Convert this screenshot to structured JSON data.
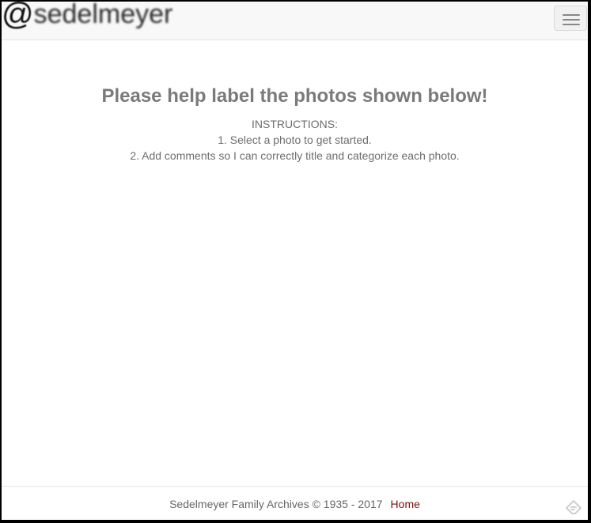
{
  "header": {
    "brand_symbol": "@",
    "brand_name": "sedelmeyer",
    "menu_icon": "hamburger-menu-icon"
  },
  "main": {
    "title": "Please help label the photos shown below!",
    "instructions_heading": "INSTRUCTIONS:",
    "instructions": [
      "1. Select a photo to get started.",
      "2. Add comments so I can correctly title and categorize each photo."
    ]
  },
  "footer": {
    "copyright": "Sedelmeyer Family Archives © 1935 - 2017",
    "home_link": "Home",
    "corner_icon": "feedly-icon"
  },
  "colors": {
    "navbar_bg": "#f8f8f8",
    "text_gray": "#777777",
    "link_color": "#7a0e0e",
    "page_bg": "#ffffff"
  }
}
